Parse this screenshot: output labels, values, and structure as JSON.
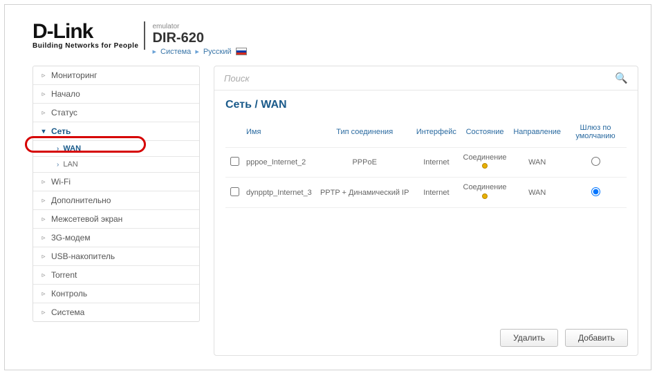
{
  "header": {
    "logo_main": "D-Link",
    "logo_sub": "Building Networks for People",
    "emu_label": "emulator",
    "model": "DIR-620",
    "breadcrumb": {
      "system": "Система",
      "lang": "Русский"
    }
  },
  "sidebar": {
    "items": [
      {
        "label": "Мониторинг"
      },
      {
        "label": "Начало"
      },
      {
        "label": "Статус"
      },
      {
        "label": "Сеть",
        "expanded": true,
        "sub": [
          {
            "label": "WAN",
            "active": true
          },
          {
            "label": "LAN"
          }
        ]
      },
      {
        "label": "Wi-Fi"
      },
      {
        "label": "Дополнительно"
      },
      {
        "label": "Межсетевой экран"
      },
      {
        "label": "3G-модем"
      },
      {
        "label": "USB-накопитель"
      },
      {
        "label": "Torrent"
      },
      {
        "label": "Контроль"
      },
      {
        "label": "Система"
      }
    ]
  },
  "search": {
    "placeholder": "Поиск"
  },
  "page": {
    "title": "Сеть / WAN"
  },
  "table": {
    "headers": {
      "name": "Имя",
      "type": "Тип соединения",
      "iface": "Интерфейс",
      "state": "Состояние",
      "direction": "Направление",
      "gateway": "Шлюз по умолчанию"
    },
    "rows": [
      {
        "name": "pppoe_Internet_2",
        "type": "PPPoE",
        "iface": "Internet",
        "state": "Соединение",
        "direction": "WAN",
        "default_gw": false
      },
      {
        "name": "dynpptp_Internet_3",
        "type": "PPTP + Динамический IP",
        "iface": "Internet",
        "state": "Соединение",
        "direction": "WAN",
        "default_gw": true
      }
    ]
  },
  "buttons": {
    "delete": "Удалить",
    "add": "Добавить"
  }
}
